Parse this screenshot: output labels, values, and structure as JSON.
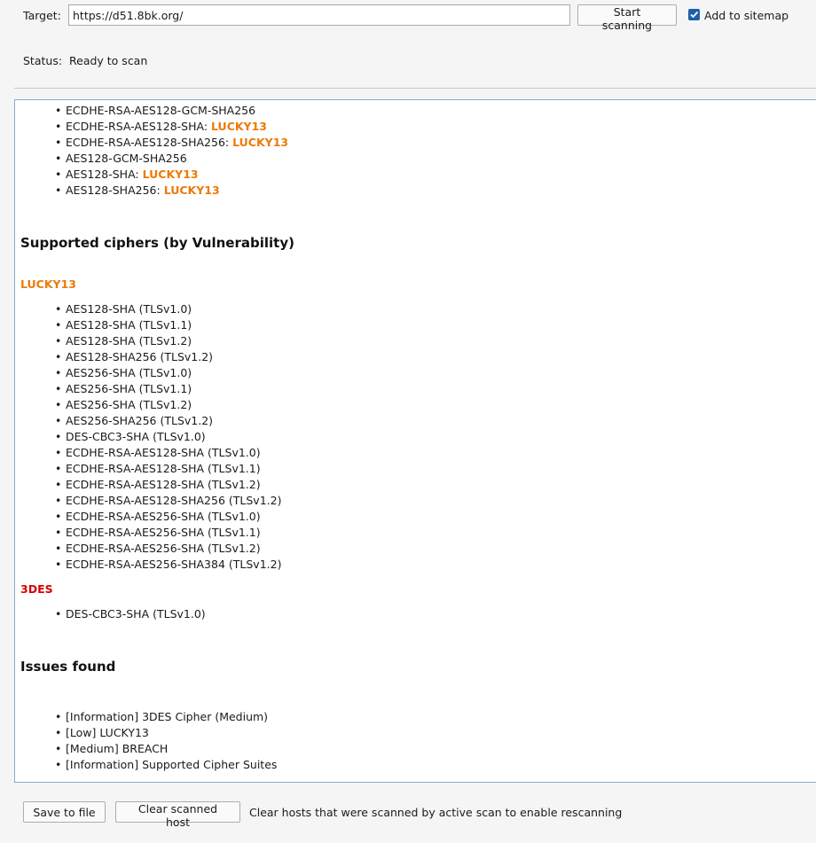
{
  "toolbar": {
    "target_label": "Target:",
    "target_value": "https://d51.8bk.org/",
    "start_button": "Start scanning",
    "add_sitemap_label": "Add to sitemap",
    "add_sitemap_checked": true,
    "status_label": "Status:",
    "status_value": "Ready to scan"
  },
  "results": {
    "top_list": [
      {
        "name": "ECDHE-RSA-AES128-GCM-SHA256",
        "sep": "",
        "vuln": ""
      },
      {
        "name": "ECDHE-RSA-AES128-SHA",
        "sep": ": ",
        "vuln": "LUCKY13"
      },
      {
        "name": "ECDHE-RSA-AES128-SHA256",
        "sep": ": ",
        "vuln": "LUCKY13"
      },
      {
        "name": "AES128-GCM-SHA256",
        "sep": "",
        "vuln": ""
      },
      {
        "name": "AES128-SHA",
        "sep": ": ",
        "vuln": "LUCKY13"
      },
      {
        "name": "AES128-SHA256",
        "sep": ": ",
        "vuln": "LUCKY13"
      }
    ],
    "by_vuln_heading": "Supported ciphers (by Vulnerability)",
    "lucky13_heading": "LUCKY13",
    "lucky13_list": [
      "AES128-SHA (TLSv1.0)",
      "AES128-SHA (TLSv1.1)",
      "AES128-SHA (TLSv1.2)",
      "AES128-SHA256 (TLSv1.2)",
      "AES256-SHA (TLSv1.0)",
      "AES256-SHA (TLSv1.1)",
      "AES256-SHA (TLSv1.2)",
      "AES256-SHA256 (TLSv1.2)",
      "DES-CBC3-SHA (TLSv1.0)",
      "ECDHE-RSA-AES128-SHA (TLSv1.0)",
      "ECDHE-RSA-AES128-SHA (TLSv1.1)",
      "ECDHE-RSA-AES128-SHA (TLSv1.2)",
      "ECDHE-RSA-AES128-SHA256 (TLSv1.2)",
      "ECDHE-RSA-AES256-SHA (TLSv1.0)",
      "ECDHE-RSA-AES256-SHA (TLSv1.1)",
      "ECDHE-RSA-AES256-SHA (TLSv1.2)",
      "ECDHE-RSA-AES256-SHA384 (TLSv1.2)"
    ],
    "des_heading": "3DES",
    "des_list": [
      "DES-CBC3-SHA (TLSv1.0)"
    ],
    "issues_heading": "Issues found",
    "issues_list": [
      "[Information] 3DES Cipher (Medium)",
      "[Low] LUCKY13",
      "[Medium] BREACH",
      "[Information] Supported Cipher Suites"
    ]
  },
  "footer": {
    "save_button": "Save to file",
    "clear_button": "Clear scanned host",
    "note": "Clear hosts that were scanned by active scan to enable rescanning"
  },
  "colors": {
    "vuln_orange": "#ec7a08",
    "vuln_red": "#d40000",
    "checkbox_blue": "#1f5fa8"
  }
}
